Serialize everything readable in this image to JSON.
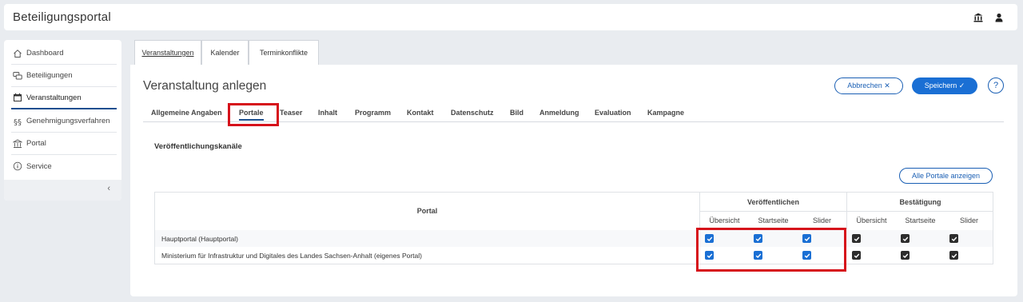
{
  "app": {
    "title": "Beteiligungsportal"
  },
  "header": {
    "icons": [
      "bank-icon",
      "user-icon"
    ]
  },
  "sidebar": {
    "items": [
      {
        "label": "Dashboard",
        "icon": "home-icon"
      },
      {
        "label": "Beteiligungen",
        "icon": "chat-icon"
      },
      {
        "label": "Veranstaltungen",
        "icon": "calendar-icon",
        "active": true
      },
      {
        "label": "Genehmigungsverfahren",
        "icon": "paragraph-icon"
      },
      {
        "label": "Portal",
        "icon": "bank-icon"
      },
      {
        "label": "Service",
        "icon": "info-icon"
      }
    ],
    "collapse_label": "‹"
  },
  "top_tabs": [
    {
      "label": "Veranstaltungen",
      "active": true
    },
    {
      "label": "Kalender"
    },
    {
      "label": "Terminkonflikte"
    }
  ],
  "page": {
    "title": "Veranstaltung anlegen",
    "cancel_label": "Abbrechen ✕",
    "save_label": "Speichern ✓",
    "help_label": "?"
  },
  "sub_tabs": [
    {
      "label": "Allgemeine Angaben"
    },
    {
      "label": "Portale",
      "active": true
    },
    {
      "label": "Teaser"
    },
    {
      "label": "Inhalt"
    },
    {
      "label": "Programm"
    },
    {
      "label": "Kontakt"
    },
    {
      "label": "Datenschutz"
    },
    {
      "label": "Bild"
    },
    {
      "label": "Anmeldung"
    },
    {
      "label": "Evaluation"
    },
    {
      "label": "Kampagne"
    }
  ],
  "section": {
    "title": "Veröffentlichungskanäle",
    "show_all_label": "Alle Portale anzeigen"
  },
  "table": {
    "portal_header": "Portal",
    "group_publish": "Veröffentlichen",
    "group_confirm": "Bestätigung",
    "sub_headers": [
      "Übersicht",
      "Startseite",
      "Slider",
      "Übersicht",
      "Startseite",
      "Slider"
    ],
    "rows": [
      {
        "portal": "Hauptportal (Hauptportal)",
        "checks": [
          true,
          true,
          true,
          true,
          true,
          true
        ]
      },
      {
        "portal": "Ministerium für Infrastruktur und Digitales des Landes Sachsen-Anhalt (eigenes Portal)",
        "checks": [
          true,
          true,
          true,
          true,
          true,
          true
        ]
      }
    ]
  },
  "colors": {
    "accent": "#1a6fd4",
    "highlight": "#d6121b",
    "active_underline": "#1c4f8f"
  }
}
